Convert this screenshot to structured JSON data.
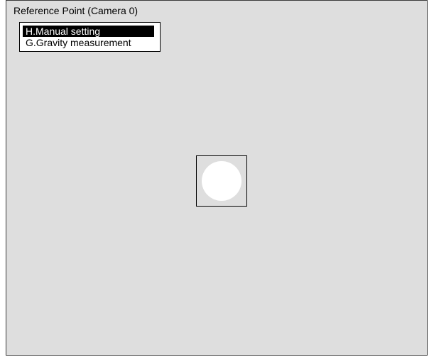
{
  "window": {
    "title": "Reference Point (Camera 0)"
  },
  "menu": {
    "items": [
      {
        "label": "H.Manual setting",
        "selected": true
      },
      {
        "label": "G.Gravity measurement",
        "selected": false
      }
    ]
  },
  "viewport": {
    "target_marker": "reference-point-marker"
  },
  "colors": {
    "background": "#dedede",
    "border": "#3a3a3a",
    "highlight": "#000000",
    "highlight_text": "#ffffff",
    "menu_background": "#ffffff",
    "marker": "#ffffff"
  }
}
